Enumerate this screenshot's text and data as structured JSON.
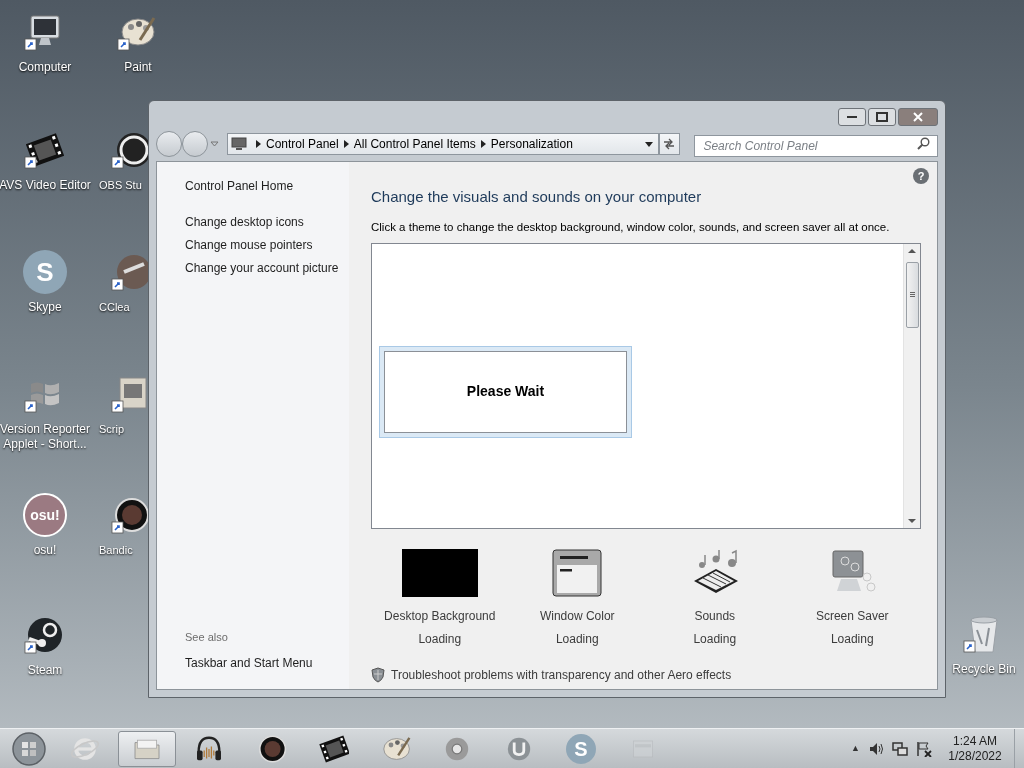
{
  "desktop_icons": [
    {
      "label": "Computer",
      "kind": "computer"
    },
    {
      "label": "Paint",
      "kind": "paint"
    },
    {
      "label": "AVS Video Editor",
      "kind": "film"
    },
    {
      "label": "OBS Stu",
      "kind": "obs"
    },
    {
      "label": "Skype",
      "kind": "skype",
      "glyph": "S"
    },
    {
      "label": "CClea",
      "kind": "ccleaner"
    },
    {
      "label": "Version Reporter Applet - Short...",
      "kind": "windows"
    },
    {
      "label": "Scrip",
      "kind": "script"
    },
    {
      "label": "osu!",
      "kind": "osu",
      "glyph": "osu!"
    },
    {
      "label": "Bandic",
      "kind": "bandicam"
    },
    {
      "label": "Steam",
      "kind": "steam"
    },
    {
      "label": "Recycle Bin",
      "kind": "recycle"
    }
  ],
  "window": {
    "breadcrumb": [
      "Control Panel",
      "All Control Panel Items",
      "Personalization"
    ],
    "search": {
      "placeholder": "Search Control Panel"
    },
    "help_glyph": "?",
    "sidebar": {
      "links": [
        "Control Panel Home",
        "Change desktop icons",
        "Change mouse pointers",
        "Change your account picture"
      ],
      "see_also_heading": "See also",
      "see_also_links": [
        "Taskbar and Start Menu"
      ]
    },
    "title": "Change the visuals and sounds on your computer",
    "subtitle": "Click a theme to change the desktop background, window color, sounds, and screen saver all at once.",
    "wait_dialog": "Please Wait",
    "settings": [
      {
        "kind": "background",
        "label": "Desktop Background",
        "status": "Loading"
      },
      {
        "kind": "color",
        "label": "Window Color",
        "status": "Loading"
      },
      {
        "kind": "sounds",
        "label": "Sounds",
        "status": "Loading"
      },
      {
        "kind": "screensaver",
        "label": "Screen Saver",
        "status": "Loading"
      }
    ],
    "troubleshoot_link": "Troubleshoot problems with transparency and other Aero effects"
  },
  "taskbar": {
    "items": [
      {
        "kind": "start",
        "selected": false
      },
      {
        "kind": "ie",
        "selected": false
      },
      {
        "kind": "explorer",
        "selected": true
      },
      {
        "kind": "headphones",
        "selected": false
      },
      {
        "kind": "bandicam",
        "selected": false
      },
      {
        "kind": "film",
        "selected": false
      },
      {
        "kind": "paint",
        "selected": false
      },
      {
        "kind": "chrome",
        "selected": false
      },
      {
        "kind": "utorrent",
        "selected": false
      },
      {
        "kind": "skype",
        "selected": false,
        "glyph": "S"
      },
      {
        "kind": "window",
        "selected": false
      }
    ],
    "tray_arrow": "▲",
    "time": "1:24 AM",
    "date": "1/28/2022"
  }
}
